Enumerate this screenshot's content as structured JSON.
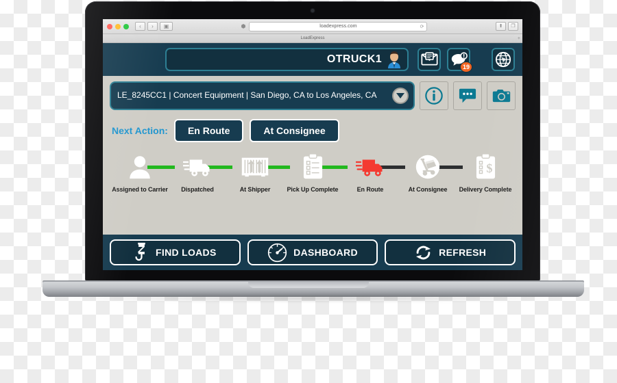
{
  "browser": {
    "url": "loadexpress.com",
    "tab_title": "LoadExpress",
    "back_glyph": "‹",
    "forward_glyph": "›",
    "sidebar_glyph": "▣",
    "shield_glyph": "⬢",
    "reload_glyph": "⟳",
    "share_glyph": "⬆",
    "tabs_glyph": "❐",
    "new_tab_glyph": "+"
  },
  "topbar": {
    "user_name": "OTRUCK1",
    "avatar_icon": "user-avatar-icon",
    "mail_icon": "envelope-icon",
    "messages_icon": "chat-alert-icon",
    "messages_badge": "19",
    "globe_icon": "globe-icon"
  },
  "load": {
    "summary": "LE_8245CC1 | Concert Equipment | San Diego, CA to Los Angeles, CA",
    "expand_icon": "chevron-down-icon",
    "info_icon": "info-circle-icon",
    "chat_icon": "chat-bubble-icon",
    "camera_icon": "camera-icon"
  },
  "next_action": {
    "label": "Next Action:",
    "buttons": [
      {
        "label": "En Route"
      },
      {
        "label": "At Consignee"
      }
    ]
  },
  "progress": {
    "steps": [
      {
        "label": "Assigned to Carrier",
        "icon": "person-icon",
        "state": "done"
      },
      {
        "label": "Dispatched",
        "icon": "truck-icon",
        "state": "done"
      },
      {
        "label": "At Shipper",
        "icon": "container-icon",
        "state": "done"
      },
      {
        "label": "Pick Up Complete",
        "icon": "clipboard-icon",
        "state": "done"
      },
      {
        "label": "En Route",
        "icon": "truck-red-icon",
        "state": "current"
      },
      {
        "label": "At Consignee",
        "icon": "hand-truck-icon",
        "state": "todo"
      },
      {
        "label": "Delivery Complete",
        "icon": "invoice-icon",
        "state": "todo"
      }
    ],
    "done_color": "#22b81e",
    "todo_color": "#2c2e30",
    "current_color": "#f43a31"
  },
  "bottom_nav": [
    {
      "label": "FIND LOADS",
      "icon": "magnet-hook-icon"
    },
    {
      "label": "DASHBOARD",
      "icon": "gauge-icon"
    },
    {
      "label": "REFRESH",
      "icon": "refresh-icon"
    }
  ],
  "theme": {
    "navy": "#173c50",
    "navy_dark": "#12303f",
    "teal": "#2d7f93",
    "accent_blue": "#2196cf",
    "page_bg": "#cfcdc6",
    "badge_orange": "#f26522"
  }
}
